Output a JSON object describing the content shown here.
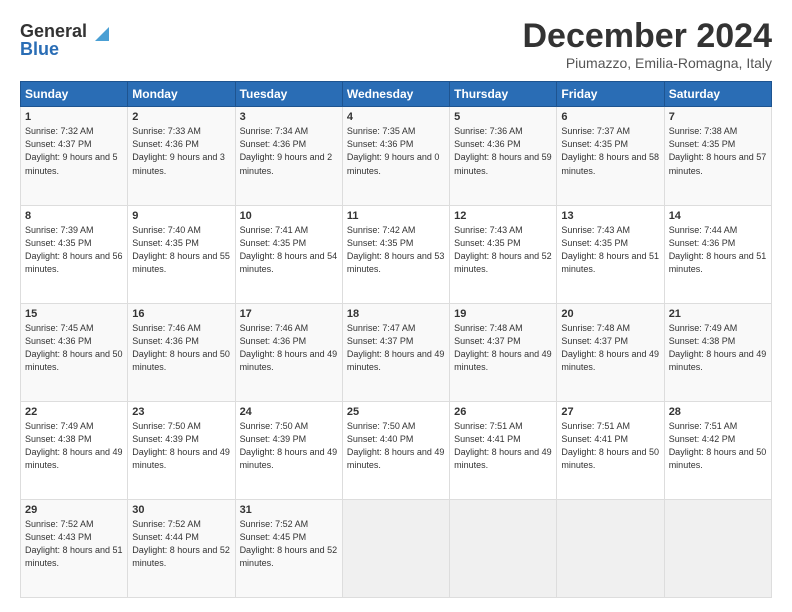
{
  "logo": {
    "general": "General",
    "blue": "Blue"
  },
  "header": {
    "month": "December 2024",
    "location": "Piumazzo, Emilia-Romagna, Italy"
  },
  "weekdays": [
    "Sunday",
    "Monday",
    "Tuesday",
    "Wednesday",
    "Thursday",
    "Friday",
    "Saturday"
  ],
  "weeks": [
    [
      {
        "day": "1",
        "sunrise": "7:32 AM",
        "sunset": "4:37 PM",
        "daylight": "9 hours and 5 minutes."
      },
      {
        "day": "2",
        "sunrise": "7:33 AM",
        "sunset": "4:36 PM",
        "daylight": "9 hours and 3 minutes."
      },
      {
        "day": "3",
        "sunrise": "7:34 AM",
        "sunset": "4:36 PM",
        "daylight": "9 hours and 2 minutes."
      },
      {
        "day": "4",
        "sunrise": "7:35 AM",
        "sunset": "4:36 PM",
        "daylight": "9 hours and 0 minutes."
      },
      {
        "day": "5",
        "sunrise": "7:36 AM",
        "sunset": "4:36 PM",
        "daylight": "8 hours and 59 minutes."
      },
      {
        "day": "6",
        "sunrise": "7:37 AM",
        "sunset": "4:35 PM",
        "daylight": "8 hours and 58 minutes."
      },
      {
        "day": "7",
        "sunrise": "7:38 AM",
        "sunset": "4:35 PM",
        "daylight": "8 hours and 57 minutes."
      }
    ],
    [
      {
        "day": "8",
        "sunrise": "7:39 AM",
        "sunset": "4:35 PM",
        "daylight": "8 hours and 56 minutes."
      },
      {
        "day": "9",
        "sunrise": "7:40 AM",
        "sunset": "4:35 PM",
        "daylight": "8 hours and 55 minutes."
      },
      {
        "day": "10",
        "sunrise": "7:41 AM",
        "sunset": "4:35 PM",
        "daylight": "8 hours and 54 minutes."
      },
      {
        "day": "11",
        "sunrise": "7:42 AM",
        "sunset": "4:35 PM",
        "daylight": "8 hours and 53 minutes."
      },
      {
        "day": "12",
        "sunrise": "7:43 AM",
        "sunset": "4:35 PM",
        "daylight": "8 hours and 52 minutes."
      },
      {
        "day": "13",
        "sunrise": "7:43 AM",
        "sunset": "4:35 PM",
        "daylight": "8 hours and 51 minutes."
      },
      {
        "day": "14",
        "sunrise": "7:44 AM",
        "sunset": "4:36 PM",
        "daylight": "8 hours and 51 minutes."
      }
    ],
    [
      {
        "day": "15",
        "sunrise": "7:45 AM",
        "sunset": "4:36 PM",
        "daylight": "8 hours and 50 minutes."
      },
      {
        "day": "16",
        "sunrise": "7:46 AM",
        "sunset": "4:36 PM",
        "daylight": "8 hours and 50 minutes."
      },
      {
        "day": "17",
        "sunrise": "7:46 AM",
        "sunset": "4:36 PM",
        "daylight": "8 hours and 49 minutes."
      },
      {
        "day": "18",
        "sunrise": "7:47 AM",
        "sunset": "4:37 PM",
        "daylight": "8 hours and 49 minutes."
      },
      {
        "day": "19",
        "sunrise": "7:48 AM",
        "sunset": "4:37 PM",
        "daylight": "8 hours and 49 minutes."
      },
      {
        "day": "20",
        "sunrise": "7:48 AM",
        "sunset": "4:37 PM",
        "daylight": "8 hours and 49 minutes."
      },
      {
        "day": "21",
        "sunrise": "7:49 AM",
        "sunset": "4:38 PM",
        "daylight": "8 hours and 49 minutes."
      }
    ],
    [
      {
        "day": "22",
        "sunrise": "7:49 AM",
        "sunset": "4:38 PM",
        "daylight": "8 hours and 49 minutes."
      },
      {
        "day": "23",
        "sunrise": "7:50 AM",
        "sunset": "4:39 PM",
        "daylight": "8 hours and 49 minutes."
      },
      {
        "day": "24",
        "sunrise": "7:50 AM",
        "sunset": "4:39 PM",
        "daylight": "8 hours and 49 minutes."
      },
      {
        "day": "25",
        "sunrise": "7:50 AM",
        "sunset": "4:40 PM",
        "daylight": "8 hours and 49 minutes."
      },
      {
        "day": "26",
        "sunrise": "7:51 AM",
        "sunset": "4:41 PM",
        "daylight": "8 hours and 49 minutes."
      },
      {
        "day": "27",
        "sunrise": "7:51 AM",
        "sunset": "4:41 PM",
        "daylight": "8 hours and 50 minutes."
      },
      {
        "day": "28",
        "sunrise": "7:51 AM",
        "sunset": "4:42 PM",
        "daylight": "8 hours and 50 minutes."
      }
    ],
    [
      {
        "day": "29",
        "sunrise": "7:52 AM",
        "sunset": "4:43 PM",
        "daylight": "8 hours and 51 minutes."
      },
      {
        "day": "30",
        "sunrise": "7:52 AM",
        "sunset": "4:44 PM",
        "daylight": "8 hours and 52 minutes."
      },
      {
        "day": "31",
        "sunrise": "7:52 AM",
        "sunset": "4:45 PM",
        "daylight": "8 hours and 52 minutes."
      },
      null,
      null,
      null,
      null
    ]
  ]
}
